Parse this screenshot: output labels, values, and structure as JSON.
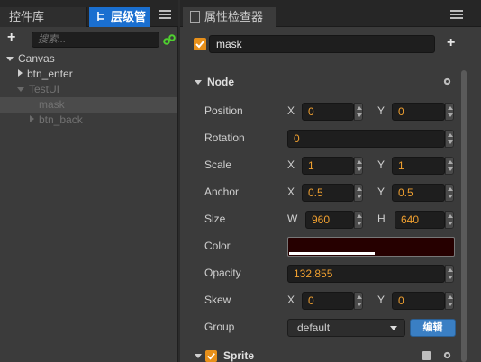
{
  "left_panel": {
    "tabs": [
      {
        "label": "控件库"
      },
      {
        "label": "层级管"
      }
    ],
    "search_placeholder": "搜索...",
    "tree": [
      {
        "label": "Canvas",
        "expanded": true
      },
      {
        "label": "btn_enter"
      },
      {
        "label": "TestUI",
        "expanded": true
      },
      {
        "label": "mask",
        "selected": true
      },
      {
        "label": "btn_back"
      }
    ]
  },
  "inspector": {
    "tab_label": "属性检查器",
    "node_name": "mask",
    "node_section": "Node",
    "props": {
      "position": {
        "label": "Position",
        "x": "0",
        "y": "0"
      },
      "rotation": {
        "label": "Rotation",
        "value": "0"
      },
      "scale": {
        "label": "Scale",
        "x": "1",
        "y": "1"
      },
      "anchor": {
        "label": "Anchor",
        "x": "0.5",
        "y": "0.5"
      },
      "size": {
        "label": "Size",
        "w": "960",
        "h": "640"
      },
      "color": {
        "label": "Color",
        "value": "#260000"
      },
      "opacity": {
        "label": "Opacity",
        "value": "132.855"
      },
      "skew": {
        "label": "Skew",
        "x": "0",
        "y": "0"
      },
      "group": {
        "label": "Group",
        "value": "default",
        "edit_label": "编辑"
      }
    },
    "axis": {
      "x": "X",
      "y": "Y",
      "w": "W",
      "h": "H"
    },
    "sprite_section": "Sprite"
  }
}
